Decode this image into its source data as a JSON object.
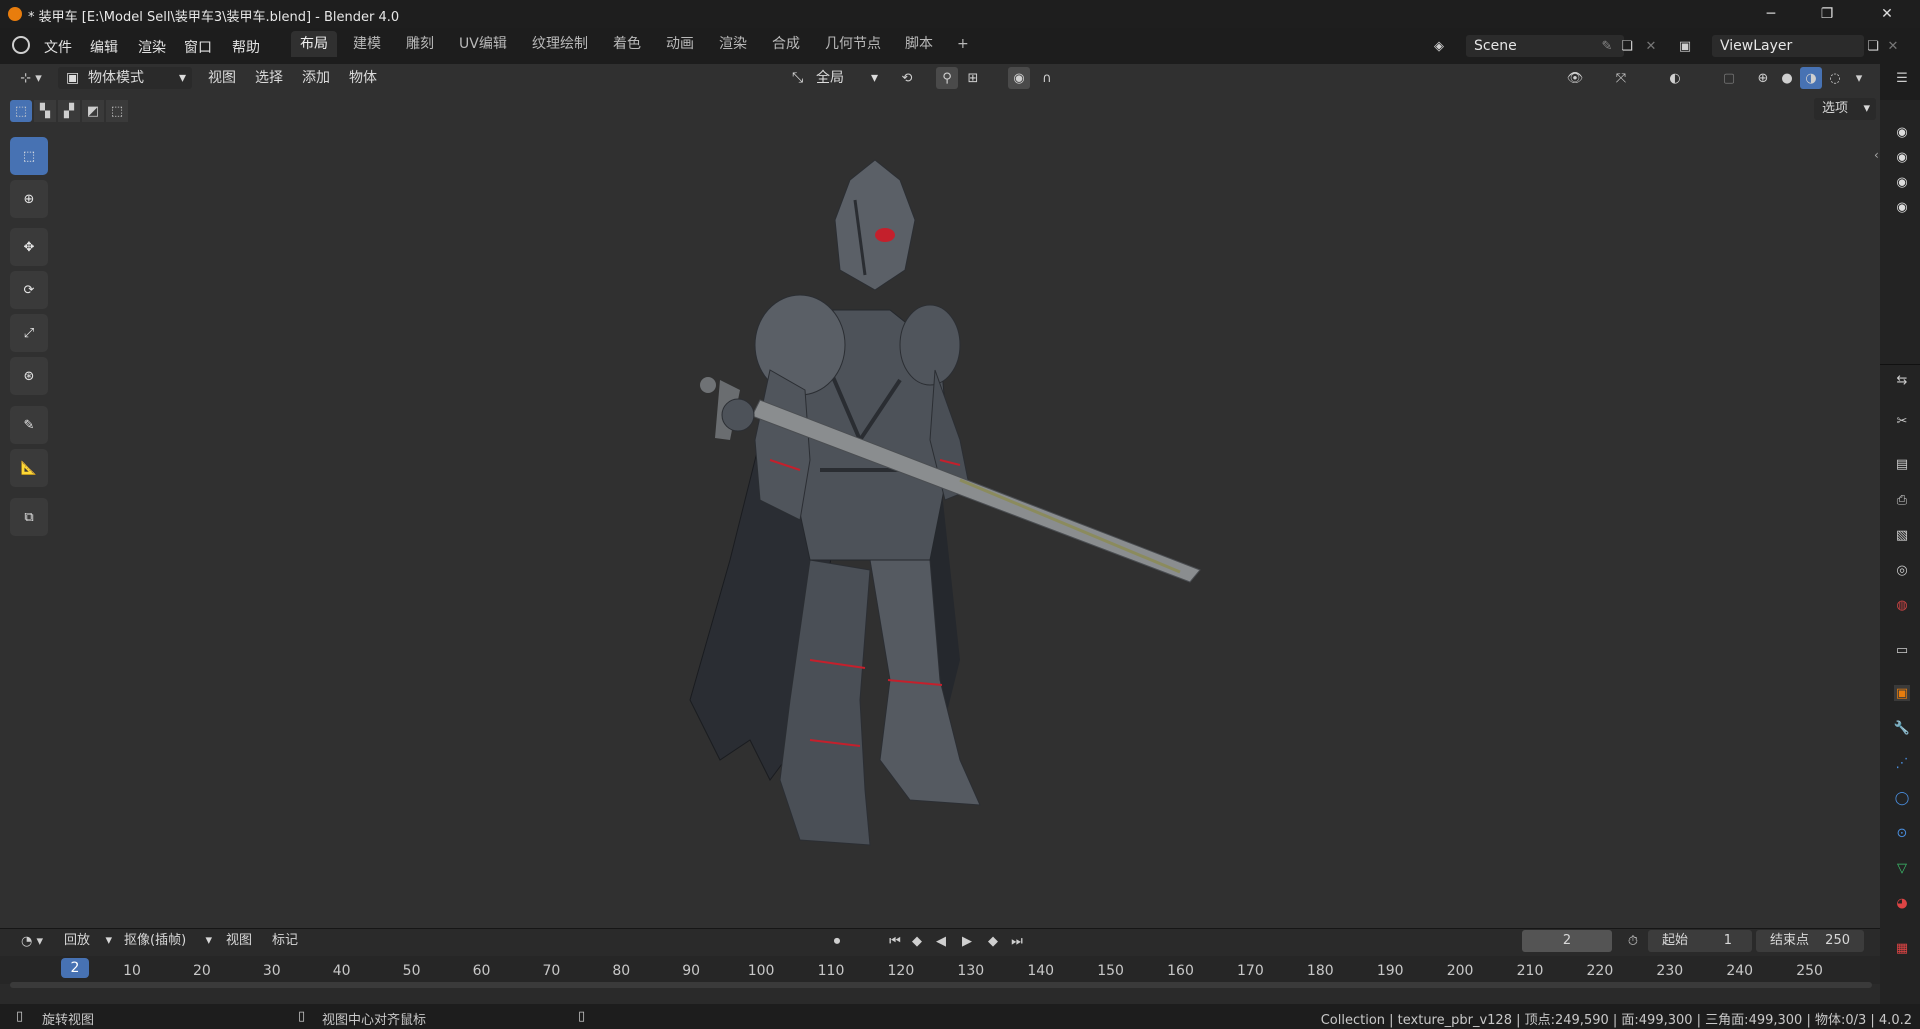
{
  "window": {
    "title": "* 装甲车 [E:\\Model Sell\\装甲车3\\装甲车.blend] - Blender 4.0",
    "minimize": "─",
    "maximize": "❐",
    "close": "✕"
  },
  "menu": [
    "文件",
    "编辑",
    "渲染",
    "窗口",
    "帮助"
  ],
  "workspaces": [
    "布局",
    "建模",
    "雕刻",
    "UV编辑",
    "纹理绘制",
    "着色",
    "动画",
    "渲染",
    "合成",
    "几何节点",
    "脚本",
    "+"
  ],
  "active_workspace": "布局",
  "scene": {
    "value": "Scene"
  },
  "view_layer": {
    "value": "ViewLayer"
  },
  "viewport_header": {
    "mode": "物体模式",
    "menus": [
      "视图",
      "选择",
      "添加",
      "物体"
    ],
    "transform_orientation": "全局",
    "options": "选项"
  },
  "tools": [
    "select-box-icon",
    "cursor-icon",
    "move-icon",
    "rotate-icon",
    "scale-icon",
    "transform-icon",
    "annotate-icon",
    "measure-icon",
    "add-cube-icon"
  ],
  "timeline": {
    "playback": "回放",
    "keying": "抠像(插帧)",
    "view": "视图",
    "marker": "标记",
    "current_frame": "2",
    "start_label": "起始",
    "start": "1",
    "end_label": "结束点",
    "end": "250",
    "ticks": [
      "10",
      "20",
      "30",
      "40",
      "50",
      "60",
      "70",
      "80",
      "90",
      "100",
      "110",
      "120",
      "130",
      "140",
      "150",
      "160",
      "170",
      "180",
      "190",
      "200",
      "210",
      "220",
      "230",
      "240",
      "250"
    ],
    "playhead": "2"
  },
  "statusbar": {
    "left_hint": "旋转视图",
    "middle_hint": "视图中心对齐鼠标",
    "stats": "Collection | texture_pbr_v128 | 顶点:249,590 | 面:499,300 | 三角面:499,300 | 物体:0/3 | 4.0.2"
  },
  "colors": {
    "accent": "#4772b3",
    "viewport_bg": "#303030",
    "header_bg": "#1d1d1d",
    "armor_accent": "#c4202c"
  }
}
